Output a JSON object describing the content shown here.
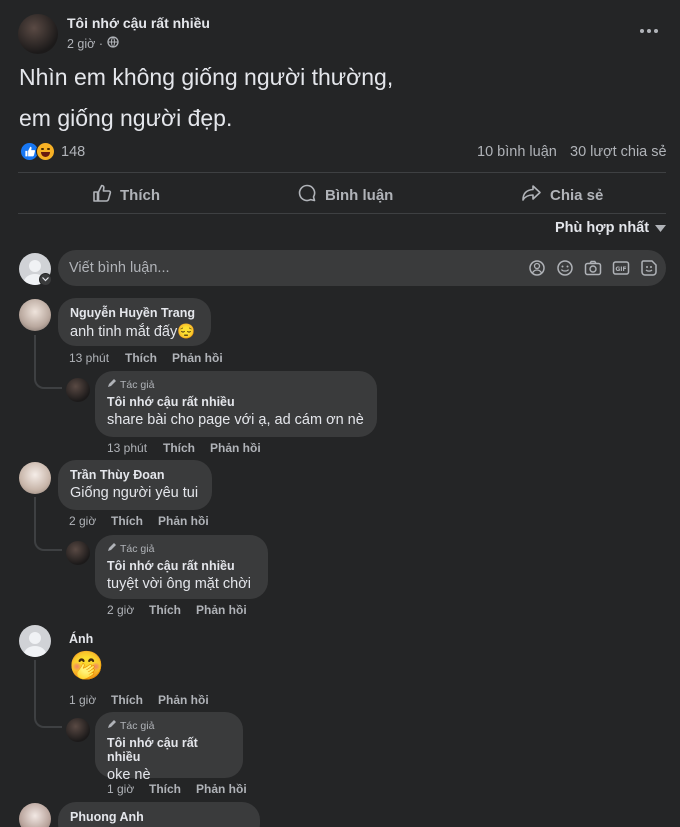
{
  "post": {
    "author": "Tôi nhớ cậu rất nhiều",
    "time": "2 giờ ·",
    "text_line1": "Nhìn em không giống người thường,",
    "text_line2": "em giống người đẹp.",
    "reaction_count": "148",
    "comment_count": "10 bình luận",
    "share_count": "30 lượt chia sẻ"
  },
  "actions": {
    "like": "Thích",
    "comment": "Bình luận",
    "share": "Chia sẻ"
  },
  "sort": {
    "label": "Phù hợp nhất"
  },
  "composer": {
    "placeholder": "Viết bình luận..."
  },
  "comments": [
    {
      "name": "Nguyễn Huyền Trang",
      "text": "anh tinh mắt đấy😔",
      "time": "13 phút",
      "like": "Thích",
      "reply": "Phản hồi",
      "replies": [
        {
          "tag": "Tác giả",
          "name": "Tôi nhớ cậu rất nhiều",
          "text": "share bài cho page với ạ, ad cám ơn nè",
          "time": "13 phút",
          "like": "Thích",
          "reply": "Phản hồi"
        }
      ]
    },
    {
      "name": "Trần Thùy Đoan",
      "text": "Giống người yêu tui",
      "time": "2 giờ",
      "like": "Thích",
      "reply": "Phản hồi",
      "replies": [
        {
          "tag": "Tác giả",
          "name": "Tôi nhớ cậu rất nhiều",
          "text": "tuyệt vời ông mặt chời",
          "time": "2 giờ",
          "like": "Thích",
          "reply": "Phản hồi"
        }
      ]
    },
    {
      "name": "Ánh",
      "text": "🤭",
      "time": "1 giờ",
      "like": "Thích",
      "reply": "Phản hồi",
      "replies": [
        {
          "tag": "Tác giả",
          "name": "Tôi nhớ cậu rất nhiều",
          "text": "oke nè",
          "time": "1 giờ",
          "like": "Thích",
          "reply": "Phản hồi"
        }
      ]
    },
    {
      "name": "Phuong Anh"
    }
  ]
}
